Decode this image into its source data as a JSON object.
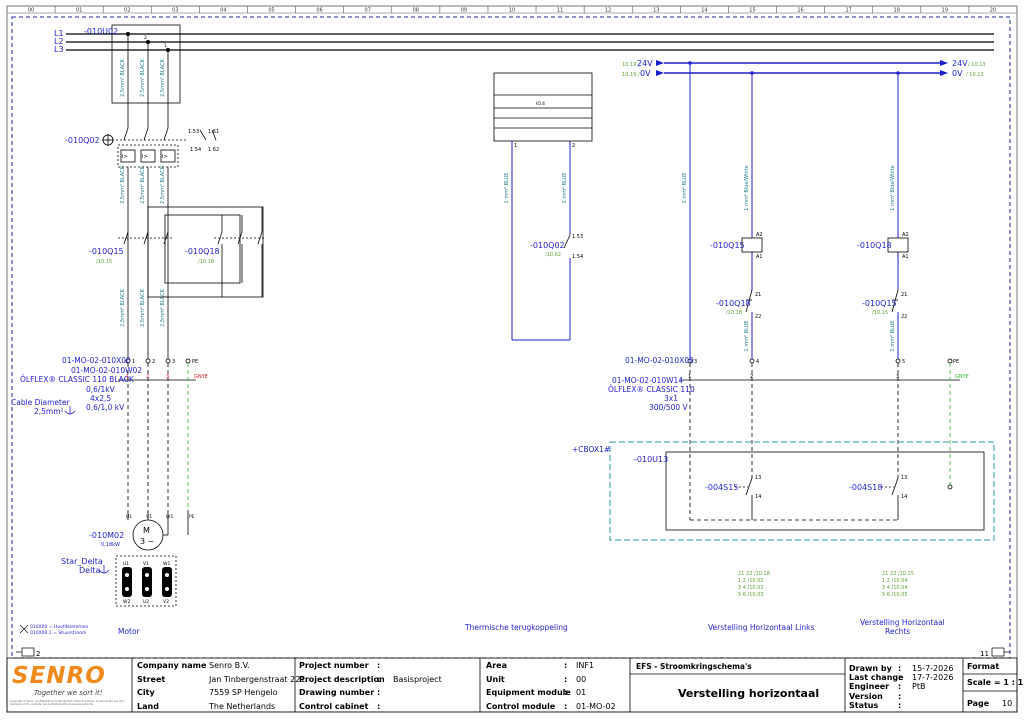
{
  "column_numbers": [
    "00",
    "01",
    "02",
    "03",
    "04",
    "05",
    "06",
    "07",
    "08",
    "09",
    "10",
    "11",
    "12",
    "13",
    "14",
    "15",
    "16",
    "17",
    "18",
    "19",
    "20"
  ],
  "phases": [
    "L1",
    "L2",
    "L3"
  ],
  "supply": {
    "positive": "24V",
    "negative": "0V",
    "ref_left_pos": "10.19 /",
    "ref_left_neg": "10.19 /",
    "ref_right_pos": "/ 10.13",
    "ref_right_neg": "/ 10.13"
  },
  "devices": {
    "main_switch": "-010U02",
    "motor_protector": "-010Q02",
    "contactor_left": "-010Q15",
    "contactor_left_ref": "/10.15",
    "contactor_right": "-010Q18",
    "contactor_right_ref": "/10.18",
    "feedback_contact": "-010Q02",
    "feedback_contact_ref": "/10.02",
    "coil_left": "-010Q15",
    "coil_right": "-010Q18",
    "interlock_left": "-010Q18",
    "interlock_left_ref": "/10.18",
    "interlock_right": "-010Q15",
    "interlock_right_ref": "/10.15",
    "motor": "-010M02",
    "motor_power": "0,18kW",
    "cbox": "+CBOX1#",
    "box_unit": "-010U13",
    "switch_left": "-004S15",
    "switch_right": "-004S18",
    "star_delta": "Star_Delta",
    "delta": "Delta",
    "thermo_label": "IO.4",
    "motor_symbol_m": "M",
    "motor_symbol_3": "3 ~"
  },
  "motor_cable": {
    "terminal": "01-MO-02-010X00",
    "cable": "01-MO-02-010W02",
    "type": "ÖLFLEX® CLASSIC 110 BLACK",
    "voltage": "0,6/1kV",
    "cores": "4x2,5",
    "rating": "0,6/1,0 kV",
    "diameter_label": "Cable Diameter",
    "diameter_value": "2,5mm²",
    "gnye": "GNYE"
  },
  "control_cable": {
    "terminal": "01-MO-02-010X00",
    "cable": "01-MO-02-010W14",
    "type": "ÖLFLEX® CLASSIC 110",
    "cores": "3x1",
    "rating": "300/500 V",
    "gnye": "GNYE"
  },
  "wire_labels": {
    "main_black": "2,5mm² BLACK",
    "main_blue": "1 mm² BLUE",
    "main_bluewhite": "1 mm² Blue/White"
  },
  "section_labels": {
    "motor": "Motor",
    "thermo": "Thermische terugkoppeling",
    "left": "Verstelling Horizontaal Links",
    "right_1": "Verstelling Horizontaal",
    "right_2": "Rechts"
  },
  "legend": {
    "line1": "010X00 = Hoofdklemmen",
    "line2": "010X00.1 = Stuurstroom"
  },
  "crossref_left": [
    "21  22  /10.18",
    "1    2  /10.02",
    "3    4  /10.02",
    "5    6  /10.03"
  ],
  "crossref_right": [
    "21  22  /10.15",
    "1    2  /10.04",
    "3    4  /10.04",
    "5    6  /10.05"
  ],
  "page_nav": {
    "prev": "2",
    "next": "11"
  },
  "title_block": {
    "logo": "SENRO",
    "slogan": "Together we sort it!",
    "copyright": "Copyright of Senro. Confidential and reproduction of this document, as well as the use and disclosure of its contents, are prohibited without express authority.",
    "company_labels": [
      "Company name",
      "Street",
      "City",
      "Land"
    ],
    "company_values": [
      "Senro B.V.",
      "Jan Tinbergenstraat 221",
      "7559 SP Hengelo",
      "The Netherlands"
    ],
    "project_labels": [
      "Project number",
      "Project description",
      "Drawing number",
      "Control cabinet"
    ],
    "project_values": [
      "",
      "Basisproject",
      "",
      ""
    ],
    "colon": ":",
    "area_labels": [
      "Area",
      "Unit",
      "Equipment module",
      "Control module"
    ],
    "area_values": [
      "INF1",
      "00",
      "01",
      "01-MO-02"
    ],
    "doc_type": "EFS - Stroomkringschema's",
    "doc_title": "Verstelling horizontaal",
    "date_labels": [
      "Drawn by",
      "Last change",
      "Engineer",
      "Version",
      "Status"
    ],
    "date_values": [
      "15-7-2026",
      "17-7-2026",
      "PtB",
      "",
      ""
    ],
    "format_label": "Format",
    "scale_label": "Scale = 1 : 1",
    "page_label": "Page",
    "page_value": "10"
  },
  "colors": {
    "wire": "#1f1fd0",
    "label": "#1a7a8a",
    "ref": "#5aa02c",
    "frame": "#1f2a9e",
    "gnye": "#2fb82f",
    "logo": "#f08a1c"
  }
}
